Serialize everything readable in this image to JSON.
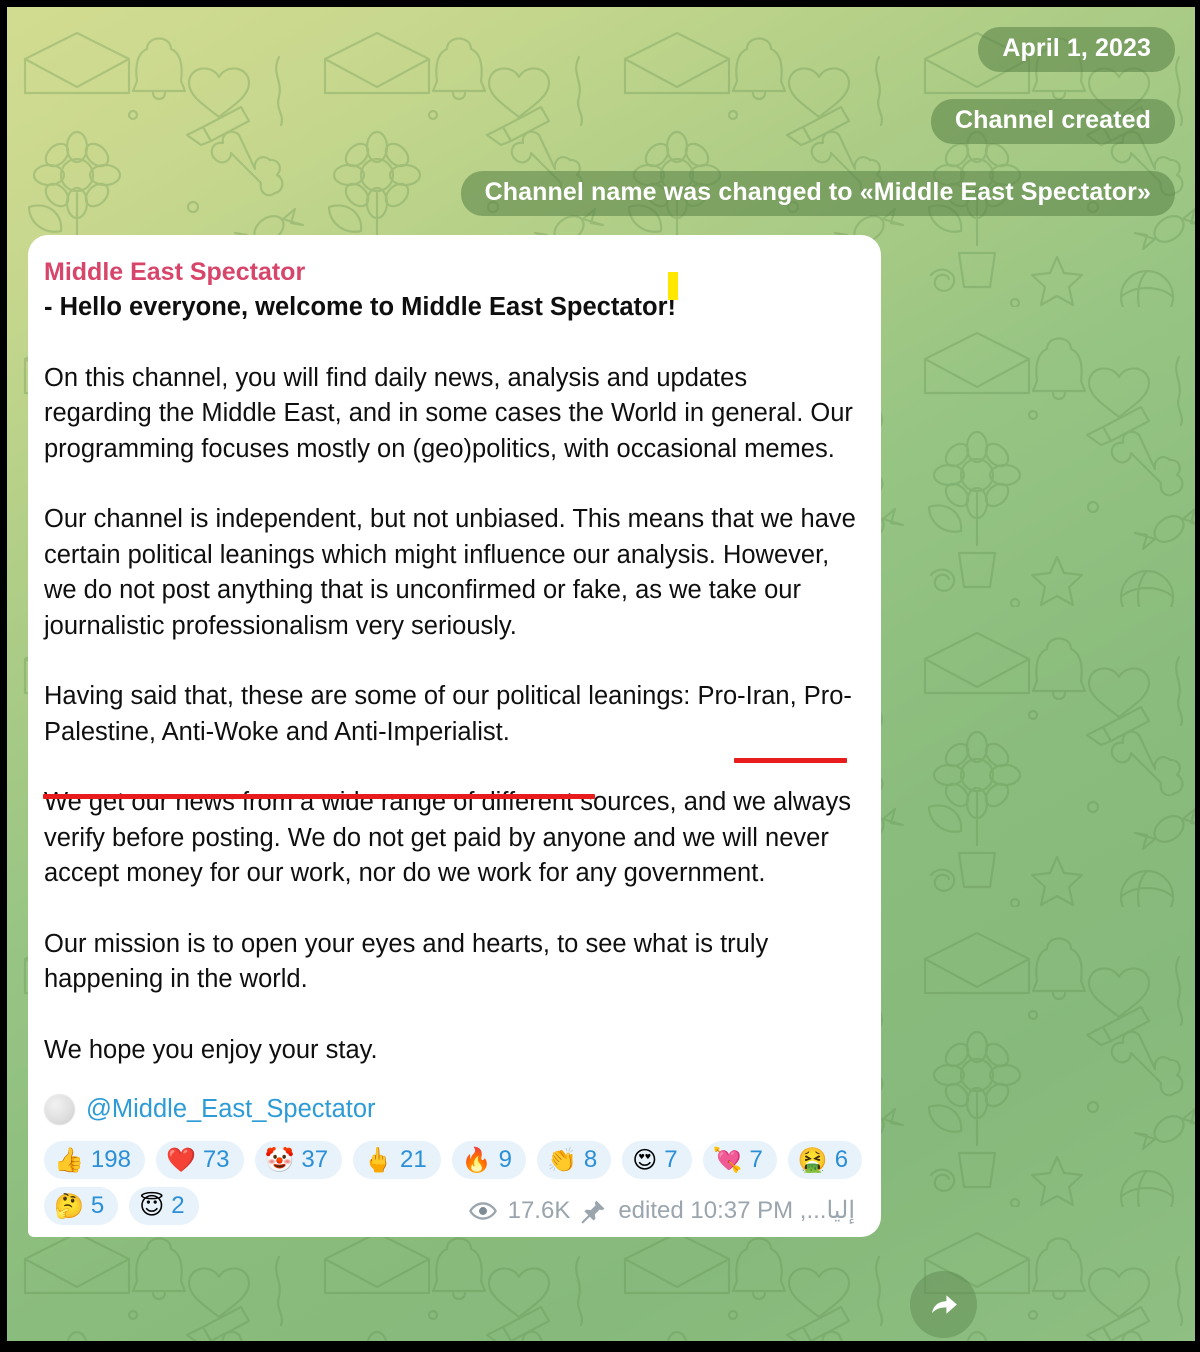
{
  "window": {
    "app": "Telegram",
    "frame_color": "#000000"
  },
  "wallpaper": {
    "description": "telegram doodle pattern",
    "gradient_start": "#d2dc91",
    "gradient_end": "#86b97b",
    "doodle_stroke": "#7aa86c"
  },
  "service_messages": [
    {
      "name": "date",
      "text": "April 1, 2023"
    },
    {
      "name": "channel-created",
      "text": "Channel created"
    },
    {
      "name": "channel-renamed",
      "text": "Channel name was changed to «Middle East Spectator»"
    }
  ],
  "message": {
    "author": "Middle East Spectator",
    "author_color": "#d8456a",
    "headline": "- Hello everyone, welcome to Middle East Spectator!",
    "paragraphs": [
      "On this channel, you will find daily news, analysis and updates regarding the Middle East, and in some cases the World in general. Our programming focuses mostly on (geo)politics, with occasional memes.",
      "Our channel is independent, but not unbiased. This means that we have certain political leanings which might influence our analysis. However, we do not post anything that is unconfirmed or fake, as we take our journalistic professionalism very seriously.",
      "Having said that, these are some of our political leanings: Pro-Iran, Pro-Palestine, Anti-Woke and Anti-Imperialist.",
      "We get our news from a wide range of different sources, and we always verify before posting. We do not get paid by anyone and we will never accept money for our work, nor do we work for any government.",
      "Our mission is to open your eyes and hearts, to see what is truly happening in the world.",
      "We hope you enjoy your stay."
    ],
    "handle": "@Middle_East_Spectator",
    "handle_color": "#2c9bd6",
    "annotations": {
      "highlight_color": "#ffe800",
      "underline_color": "#e81c1c"
    }
  },
  "reactions": [
    {
      "name": "thumbs-up",
      "emoji": "👍",
      "count": "198"
    },
    {
      "name": "red-heart",
      "emoji": "❤️",
      "count": "73"
    },
    {
      "name": "clown-face",
      "emoji": "🤡",
      "count": "37"
    },
    {
      "name": "middle-finger",
      "emoji": "🖕",
      "count": "21"
    },
    {
      "name": "fire",
      "emoji": "🔥",
      "count": "9"
    },
    {
      "name": "clapping-hands",
      "emoji": "👏",
      "count": "8"
    },
    {
      "name": "heart-eyes",
      "emoji": "😍",
      "count": "7"
    },
    {
      "name": "broken-heart",
      "emoji": "💘",
      "count": "7"
    },
    {
      "name": "vomiting-face",
      "emoji": "🤮",
      "count": "6"
    },
    {
      "name": "thinking-face",
      "emoji": "🤔",
      "count": "5"
    },
    {
      "name": "halo-face",
      "emoji": "😇",
      "count": "2"
    }
  ],
  "footer": {
    "views": "17.6K",
    "pinned": true,
    "edited": "edited 10:37 PM ,...إليا"
  },
  "forward_button": {
    "label": "forward"
  }
}
